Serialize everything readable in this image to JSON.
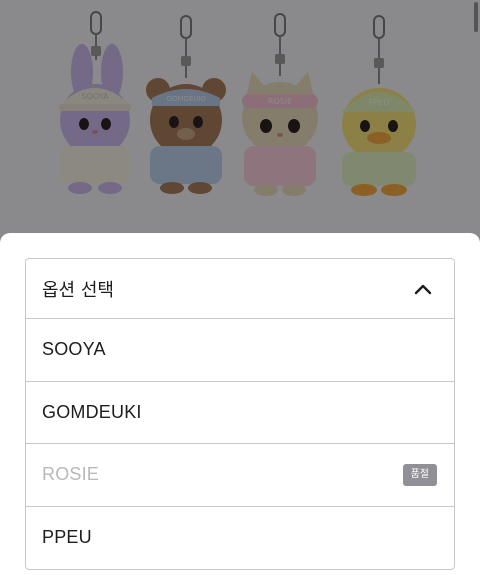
{
  "product_image": {
    "characters": [
      {
        "name": "SOOYA",
        "cap_text": "SOOYA",
        "body_color": "#c9b6e8",
        "cap_color": "#eee9df",
        "outfit_color": "#f1ecde"
      },
      {
        "name": "GOMDEUKI",
        "cap_text": "GOMDEUKI",
        "body_color": "#a47a58",
        "cap_color": "#b6c9e6",
        "outfit_color": "#b9cbe8"
      },
      {
        "name": "ROSIE",
        "cap_text": "ROSIE",
        "body_color": "#e6d7b8",
        "cap_color": "#f1bed0",
        "outfit_color": "#f3c9d8"
      },
      {
        "name": "PPEU",
        "cap_text": "PPEU",
        "body_color": "#f2dd7a",
        "cap_color": "#d9eab4",
        "outfit_color": "#dcecbf"
      }
    ]
  },
  "option_select": {
    "title": "옵션 선택",
    "options": [
      {
        "label": "SOOYA",
        "sold_out": false
      },
      {
        "label": "GOMDEUKI",
        "sold_out": false
      },
      {
        "label": "ROSIE",
        "sold_out": true,
        "badge": "품절"
      },
      {
        "label": "PPEU",
        "sold_out": false
      }
    ]
  },
  "colors": {
    "sheet_background": "#ffffff",
    "border": "#c9c9cc",
    "disabled_text": "#b9b9bd",
    "badge_background": "#909096"
  }
}
